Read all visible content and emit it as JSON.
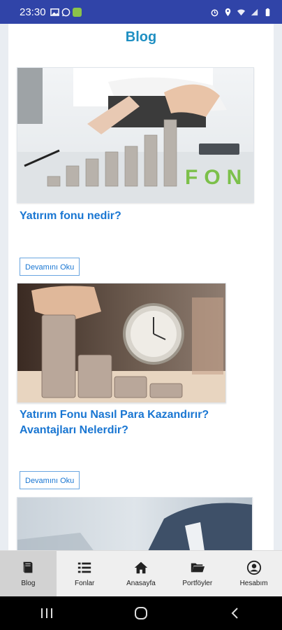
{
  "status_bar": {
    "time": "23:30",
    "left_icons": [
      "gallery-icon",
      "whatsapp-icon",
      "app-icon"
    ],
    "right_icons": [
      "alarm-icon",
      "location-icon",
      "wifi-icon",
      "signal-icon",
      "battery-icon"
    ]
  },
  "page": {
    "title": "Blog"
  },
  "posts": [
    {
      "title": "Yatırım fonu nedir?",
      "image_text": "FON",
      "read_more": "Devamını Oku"
    },
    {
      "title": "Yatırım Fonu Nasıl Para Kazandırır? Avantajları Nelerdir?",
      "read_more": "Devamını Oku"
    },
    {
      "title": ""
    }
  ],
  "bottom_nav": [
    {
      "label": "Blog",
      "icon": "book-icon",
      "active": true
    },
    {
      "label": "Fonlar",
      "icon": "list-icon",
      "active": false
    },
    {
      "label": "Anasayfa",
      "icon": "home-icon",
      "active": false
    },
    {
      "label": "Portföyler",
      "icon": "folder-icon",
      "active": false
    },
    {
      "label": "Hesabım",
      "icon": "account-icon",
      "active": false
    }
  ],
  "colors": {
    "status_bar": "#3044a8",
    "title": "#1f8fc2",
    "link": "#1976d2"
  }
}
